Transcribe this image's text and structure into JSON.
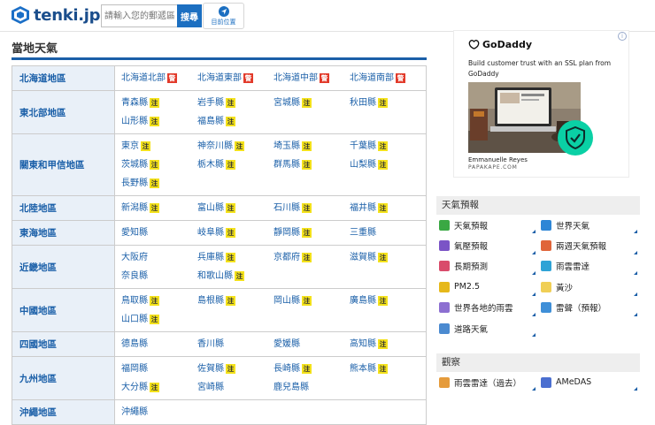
{
  "header": {
    "logo_text": "tenki.jp",
    "search_placeholder": "請輸入您的郵遞區號",
    "search_button": "搜尋",
    "location_label": "目前位置"
  },
  "section_title": "當地天氣",
  "regions": [
    {
      "name": "北海道地區",
      "prefs": [
        {
          "name": "北海道北部",
          "badge": "警",
          "badge_type": "alert"
        },
        {
          "name": "北海道東部",
          "badge": "警",
          "badge_type": "alert"
        },
        {
          "name": "北海道中部",
          "badge": "警",
          "badge_type": "alert"
        },
        {
          "name": "北海道南部",
          "badge": "警",
          "badge_type": "alert"
        }
      ]
    },
    {
      "name": "東北部地區",
      "prefs": [
        {
          "name": "青森縣",
          "badge": "注",
          "badge_type": "warn"
        },
        {
          "name": "岩手縣",
          "badge": "注",
          "badge_type": "warn"
        },
        {
          "name": "宮城縣",
          "badge": "注",
          "badge_type": "warn"
        },
        {
          "name": "秋田縣",
          "badge": "注",
          "badge_type": "warn"
        },
        {
          "name": "山形縣",
          "badge": "注",
          "badge_type": "warn"
        },
        {
          "name": "福島縣",
          "badge": "注",
          "badge_type": "warn"
        }
      ]
    },
    {
      "name": "關東和甲信地區",
      "prefs": [
        {
          "name": "東京",
          "badge": "注",
          "badge_type": "warn"
        },
        {
          "name": "神奈川縣",
          "badge": "注",
          "badge_type": "warn"
        },
        {
          "name": "埼玉縣",
          "badge": "注",
          "badge_type": "warn"
        },
        {
          "name": "千葉縣",
          "badge": "注",
          "badge_type": "warn"
        },
        {
          "name": "茨城縣",
          "badge": "注",
          "badge_type": "warn"
        },
        {
          "name": "栃木縣",
          "badge": "注",
          "badge_type": "warn"
        },
        {
          "name": "群馬縣",
          "badge": "注",
          "badge_type": "warn"
        },
        {
          "name": "山梨縣",
          "badge": "注",
          "badge_type": "warn"
        },
        {
          "name": "長野縣",
          "badge": "注",
          "badge_type": "warn"
        }
      ]
    },
    {
      "name": "北陸地區",
      "prefs": [
        {
          "name": "新潟縣",
          "badge": "注",
          "badge_type": "warn"
        },
        {
          "name": "富山縣",
          "badge": "注",
          "badge_type": "warn"
        },
        {
          "name": "石川縣",
          "badge": "注",
          "badge_type": "warn"
        },
        {
          "name": "福井縣",
          "badge": "注",
          "badge_type": "warn"
        }
      ]
    },
    {
      "name": "東海地區",
      "prefs": [
        {
          "name": "愛知縣",
          "badge": "",
          "badge_type": ""
        },
        {
          "name": "岐阜縣",
          "badge": "注",
          "badge_type": "warn"
        },
        {
          "name": "靜岡縣",
          "badge": "注",
          "badge_type": "warn"
        },
        {
          "name": "三重縣",
          "badge": "",
          "badge_type": ""
        }
      ]
    },
    {
      "name": "近畿地區",
      "prefs": [
        {
          "name": "大阪府",
          "badge": "",
          "badge_type": ""
        },
        {
          "name": "兵庫縣",
          "badge": "注",
          "badge_type": "warn"
        },
        {
          "name": "京都府",
          "badge": "注",
          "badge_type": "warn"
        },
        {
          "name": "滋賀縣",
          "badge": "注",
          "badge_type": "warn"
        },
        {
          "name": "奈良縣",
          "badge": "",
          "badge_type": ""
        },
        {
          "name": "和歌山縣",
          "badge": "注",
          "badge_type": "warn"
        }
      ]
    },
    {
      "name": "中國地區",
      "prefs": [
        {
          "name": "鳥取縣",
          "badge": "注",
          "badge_type": "warn"
        },
        {
          "name": "島根縣",
          "badge": "注",
          "badge_type": "warn"
        },
        {
          "name": "岡山縣",
          "badge": "注",
          "badge_type": "warn"
        },
        {
          "name": "廣島縣",
          "badge": "注",
          "badge_type": "warn"
        },
        {
          "name": "山口縣",
          "badge": "注",
          "badge_type": "warn"
        }
      ]
    },
    {
      "name": "四國地區",
      "prefs": [
        {
          "name": "德島縣",
          "badge": "",
          "badge_type": ""
        },
        {
          "name": "香川縣",
          "badge": "",
          "badge_type": ""
        },
        {
          "name": "愛媛縣",
          "badge": "",
          "badge_type": ""
        },
        {
          "name": "高知縣",
          "badge": "注",
          "badge_type": "warn"
        }
      ]
    },
    {
      "name": "九州地區",
      "prefs": [
        {
          "name": "福岡縣",
          "badge": "",
          "badge_type": ""
        },
        {
          "name": "佐賀縣",
          "badge": "注",
          "badge_type": "warn"
        },
        {
          "name": "長崎縣",
          "badge": "注",
          "badge_type": "warn"
        },
        {
          "name": "熊本縣",
          "badge": "注",
          "badge_type": "warn"
        },
        {
          "name": "大分縣",
          "badge": "注",
          "badge_type": "warn"
        },
        {
          "name": "宮崎縣",
          "badge": "",
          "badge_type": ""
        },
        {
          "name": "鹿兒島縣",
          "badge": "",
          "badge_type": ""
        }
      ]
    },
    {
      "name": "沖繩地區",
      "prefs": [
        {
          "name": "沖繩縣",
          "badge": "",
          "badge_type": ""
        }
      ]
    }
  ],
  "ad": {
    "brand": "GoDaddy",
    "copy": "Build customer trust with an SSL plan from GoDaddy",
    "person": "Emmanuelle Reyes",
    "credit": "PAPAKAPE.COM",
    "info_glyph": "i"
  },
  "forecast_panel": {
    "title": "天氣預報",
    "items": [
      {
        "label": "天氣預報",
        "icon": "weather-forecast-icon",
        "color": "#3aa843"
      },
      {
        "label": "世界天氣",
        "icon": "globe-icon",
        "color": "#2e86d6"
      },
      {
        "label": "氣壓預報",
        "icon": "pressure-icon",
        "color": "#7b54c6"
      },
      {
        "label": "兩週天氣預報",
        "icon": "two-week-icon",
        "color": "#e0653a"
      },
      {
        "label": "長期預測",
        "icon": "calendar-icon",
        "color": "#d94c6b"
      },
      {
        "label": "雨雲雷達",
        "icon": "rain-radar-icon",
        "color": "#2fa3d6"
      },
      {
        "label": "PM2.5",
        "icon": "pm25-icon",
        "color": "#e6b81a"
      },
      {
        "label": "黃沙",
        "icon": "yellow-sand-icon",
        "color": "#f0cf56"
      },
      {
        "label": "世界各地的雨雲",
        "icon": "world-rain-icon",
        "color": "#8c6fd1"
      },
      {
        "label": "雷聲（預報）",
        "icon": "thunder-icon",
        "color": "#3f8fd8"
      },
      {
        "label": "道路天氣",
        "icon": "road-icon",
        "color": "#4b8ad0"
      }
    ]
  },
  "observation_panel": {
    "title": "觀察",
    "items": [
      {
        "label": "雨雲雷達（過去）",
        "icon": "rain-radar-past-icon",
        "color": "#e59b3c"
      },
      {
        "label": "AMeDAS",
        "icon": "amedas-icon",
        "color": "#4b6fd0"
      }
    ]
  }
}
